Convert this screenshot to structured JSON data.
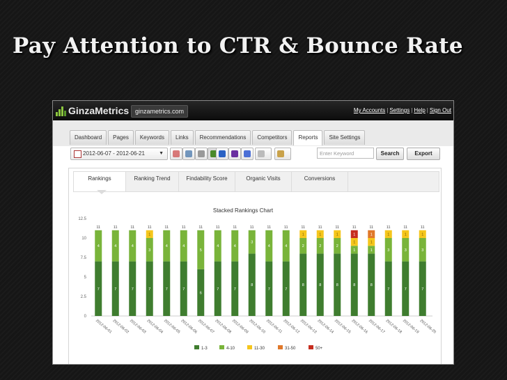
{
  "slide": {
    "title": "Pay Attention to CTR & Bounce Rate"
  },
  "app": {
    "logo": "GinzaMetrics",
    "site": "ginzametrics.com",
    "toplinks": [
      "My Accounts",
      "Settings",
      "Help",
      "Sign Out"
    ],
    "separator": "|"
  },
  "nav": {
    "tabs": [
      "Dashboard",
      "Pages",
      "Keywords",
      "Links",
      "Recommendations",
      "Competitors",
      "Reports",
      "Site Settings"
    ],
    "active": "Reports"
  },
  "toolbar": {
    "date_range": "2012-06-07 - 2012-06-21",
    "keyword_placeholder": "Enter Keyword",
    "search_label": "Search",
    "export_label": "Export"
  },
  "report_tabs": [
    "Rankings",
    "Ranking Trend",
    "Findability Score",
    "Organic Visits",
    "Conversions"
  ],
  "colors": {
    "c1_3": "#3f7d2f",
    "c4_10": "#79b43a",
    "c11_30": "#f5c61c",
    "c31_50": "#e0782a",
    "c50p": "#c62d1f"
  },
  "chart_data": {
    "type": "bar",
    "stacked": true,
    "title": "Stacked Rankings Chart",
    "categories": [
      "2012-06-01",
      "2012-06-02",
      "2012-06-03",
      "2012-06-04",
      "2012-06-05",
      "2012-06-06",
      "2012-06-07",
      "2012-06-08",
      "2012-06-09",
      "2012-06-10",
      "2012-06-11",
      "2012-06-12",
      "2012-06-13",
      "2012-06-14",
      "2012-06-15",
      "2012-06-16",
      "2012-06-17",
      "2012-06-18",
      "2012-06-19",
      "2012-06-20"
    ],
    "totals": [
      11,
      11,
      11,
      11,
      11,
      11,
      11,
      11,
      11,
      11,
      11,
      11,
      11,
      11,
      11,
      11,
      11,
      11,
      11,
      11
    ],
    "yticks": [
      "0",
      "2.5",
      "5",
      "7.5",
      "10",
      "12.5"
    ],
    "ylim": [
      0,
      12.5
    ],
    "grid": false,
    "legend_position": "bottom",
    "series": [
      {
        "name": "1-3",
        "color": "#3f7d2f",
        "values": [
          7,
          7,
          7,
          7,
          7,
          7,
          6,
          7,
          7,
          8,
          7,
          7,
          8,
          8,
          8,
          8,
          8,
          7,
          7,
          7,
          7
        ]
      },
      {
        "name": "4-10",
        "color": "#79b43a",
        "values": [
          4,
          4,
          4,
          3,
          4,
          4,
          5,
          4,
          4,
          3,
          4,
          4,
          2,
          2,
          2,
          1,
          1,
          3,
          3,
          3,
          3
        ]
      },
      {
        "name": "11-30",
        "color": "#f5c61c",
        "values": [
          0,
          0,
          0,
          1,
          0,
          0,
          0,
          0,
          0,
          0,
          0,
          0,
          1,
          1,
          1,
          1,
          1,
          1,
          1,
          1,
          1
        ]
      },
      {
        "name": "31-50",
        "color": "#e0782a",
        "values": [
          0,
          0,
          0,
          0,
          0,
          0,
          0,
          0,
          0,
          0,
          0,
          0,
          0,
          0,
          0,
          0,
          1,
          0,
          0,
          0,
          0
        ]
      },
      {
        "name": "50+",
        "color": "#c62d1f",
        "values": [
          0,
          0,
          0,
          0,
          0,
          0,
          0,
          0,
          0,
          0,
          0,
          0,
          0,
          0,
          0,
          1,
          0,
          0,
          0,
          0,
          0
        ]
      }
    ]
  }
}
